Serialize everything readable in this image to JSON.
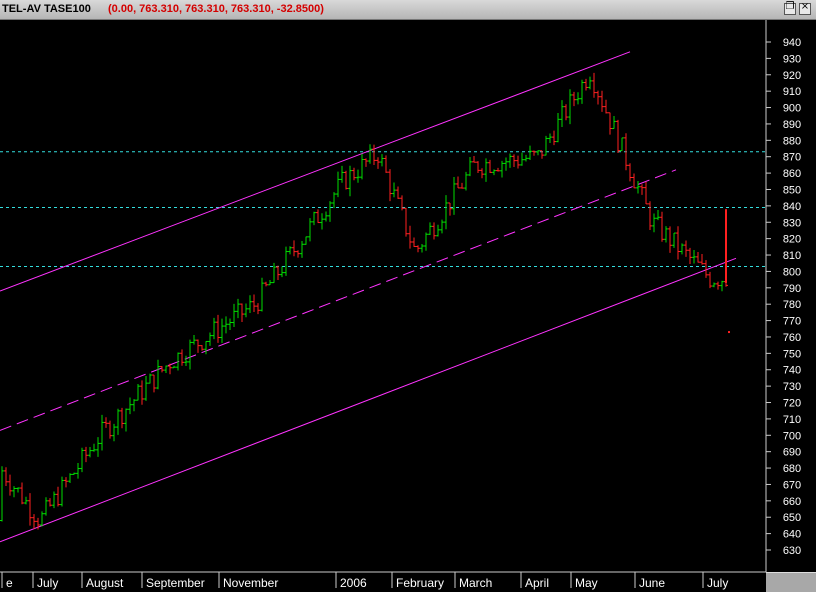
{
  "window": {
    "title": "TEL-AV TASE100",
    "values": "(0.00, 763.310, 763.310, 763.310, -32.8500)",
    "restore_icon": "restore-icon",
    "close_icon": "close-icon"
  },
  "colors": {
    "background": "#000000",
    "up_bar": "#00dd00",
    "down_bar": "#ff2020",
    "channel": "#ff33ff",
    "support": "#33dddd",
    "axis_text": "#ffffff"
  },
  "chart_data": {
    "type": "bar",
    "ohlc": true,
    "ylim": [
      623,
      947
    ],
    "y_ticks": [
      630,
      640,
      650,
      660,
      670,
      680,
      690,
      700,
      710,
      720,
      730,
      740,
      750,
      760,
      770,
      780,
      790,
      800,
      810,
      820,
      830,
      840,
      850,
      860,
      870,
      880,
      890,
      900,
      910,
      920,
      930,
      940
    ],
    "x_ticks": [
      "e",
      "July",
      "August",
      "September",
      "November",
      "2006",
      "February",
      "March",
      "April",
      "May",
      "June",
      "July"
    ],
    "support_levels": [
      873,
      839,
      803
    ],
    "channel_upper": {
      "from": [
        "June 2005",
        788
      ],
      "to": [
        "May 2006",
        934
      ]
    },
    "channel_middle": {
      "from": [
        "June 2005",
        703
      ],
      "to": [
        "June 2006",
        862
      ],
      "dashed": true
    },
    "channel_lower": {
      "from": [
        "June 2005",
        635
      ],
      "to": [
        "July 2006",
        808
      ]
    },
    "last_close_marker": 763,
    "price_path": [
      {
        "x": "July 2005",
        "close": 648
      },
      {
        "x": "August 2005",
        "close": 700
      },
      {
        "x": "September 2005",
        "close": 745
      },
      {
        "x": "October 2005",
        "close": 770
      },
      {
        "x": "November 2005",
        "close": 780
      },
      {
        "x": "2006",
        "close": 855
      },
      {
        "x": "January 2006",
        "close": 872
      },
      {
        "x": "February 2006",
        "close": 812
      },
      {
        "x": "March 2006",
        "close": 865
      },
      {
        "x": "April 2006",
        "close": 870
      },
      {
        "x": "May 2006",
        "close": 922
      },
      {
        "x": "June 2006",
        "close": 830
      },
      {
        "x": "July 2006",
        "close": 796
      }
    ]
  }
}
